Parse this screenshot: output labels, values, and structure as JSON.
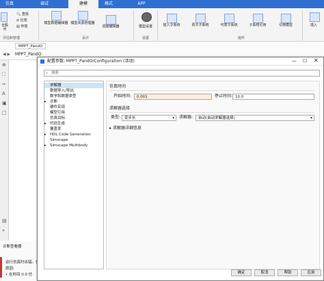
{
  "tabs": [
    {
      "label": "仿真",
      "active": false
    },
    {
      "label": "调试",
      "active": false
    },
    {
      "label": "建模",
      "active": true
    },
    {
      "label": "格式",
      "active": false
    },
    {
      "label": "APP",
      "active": false
    }
  ],
  "ribbon": {
    "left_items": [
      "查找",
      "比较",
      "环境"
    ],
    "left_fragment": "台股问",
    "buttons": [
      "模型数据编辑器",
      "模型资源管理器",
      "调度编辑器",
      "模型设置",
      "插入子系统",
      "原子子系统",
      "可变子系统",
      "子系统引用",
      "引用模型",
      "插入"
    ],
    "sections": [
      "评估和管理",
      "设计",
      "设置",
      "组件"
    ]
  },
  "breadcrumb": {
    "tab": "MPPT_PandO",
    "path": "MPPT_PandO"
  },
  "bottom_panel": {
    "header": "诊断查看器",
    "lines": [
      "运行仿真时出错。仿",
      "原因:",
      "• 在时间 0.0 仿"
    ]
  },
  "dialog": {
    "title": "配置参数: MPPT_PandO/Configuration (活动)",
    "search_placeholder": "搜索",
    "tree": [
      {
        "label": "求解器",
        "indent": 0,
        "selected": true,
        "arrow": ""
      },
      {
        "label": "数据导入/导出",
        "indent": 0,
        "selected": false,
        "arrow": ""
      },
      {
        "label": "数学和数据类型",
        "indent": 0,
        "selected": false,
        "arrow": ""
      },
      {
        "label": "诊断",
        "indent": 0,
        "selected": false,
        "arrow": "▸"
      },
      {
        "label": "硬件实现",
        "indent": 0,
        "selected": false,
        "arrow": ""
      },
      {
        "label": "模型引用",
        "indent": 0,
        "selected": false,
        "arrow": ""
      },
      {
        "label": "仿真目标",
        "indent": 0,
        "selected": false,
        "arrow": ""
      },
      {
        "label": "代码生成",
        "indent": 0,
        "selected": false,
        "arrow": "▸"
      },
      {
        "label": "覆盖率",
        "indent": 0,
        "selected": false,
        "arrow": ""
      },
      {
        "label": "HDL Code Generation",
        "indent": 0,
        "selected": false,
        "arrow": "▸"
      },
      {
        "label": "Simscape",
        "indent": 0,
        "selected": false,
        "arrow": ""
      },
      {
        "label": "Simscape Multibody",
        "indent": 0,
        "selected": false,
        "arrow": "▸"
      }
    ],
    "sim_time": {
      "header": "仿真时间",
      "start_label": "开始时间:",
      "start_value": "0.001",
      "stop_label": "停止时间:",
      "stop_value": "10.0"
    },
    "solver_select": {
      "header": "求解器选择",
      "type_label": "类型:",
      "type_value": "变步长",
      "solver_label": "求解器:",
      "solver_value": "自动(自动求解器选择)"
    },
    "solver_details": "求解器详细信息",
    "buttons": {
      "ok": "确定",
      "cancel": "取消",
      "help": "帮助",
      "apply": "应用"
    }
  }
}
